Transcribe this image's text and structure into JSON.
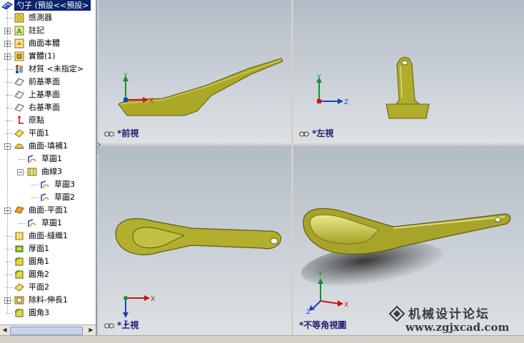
{
  "tree": {
    "root": "勺子 (預設<<預設>",
    "items": [
      {
        "label": "感測器",
        "icon": "sensor-icon",
        "expandable": false
      },
      {
        "label": "註記",
        "icon": "annotation-icon",
        "expandable": true
      },
      {
        "label": "曲面本體",
        "icon": "surface-bodies-icon",
        "expandable": true
      },
      {
        "label": "實體(1)",
        "icon": "solid-bodies-icon",
        "expandable": true
      },
      {
        "label": "材質 <未指定>",
        "icon": "material-icon",
        "expandable": false
      },
      {
        "label": "前基準面",
        "icon": "plane-icon",
        "expandable": false
      },
      {
        "label": "上基準面",
        "icon": "plane-icon",
        "expandable": false
      },
      {
        "label": "右基準面",
        "icon": "plane-icon",
        "expandable": false
      },
      {
        "label": "原點",
        "icon": "origin-icon",
        "expandable": false
      },
      {
        "label": "平面1",
        "icon": "plane-feature-icon",
        "expandable": false
      },
      {
        "label": "曲面-填補1",
        "icon": "surface-fill-icon",
        "expandable": true,
        "expanded": true
      },
      {
        "label": "草圖1",
        "icon": "sketch-icon",
        "level": 1
      },
      {
        "label": "曲線3",
        "icon": "curve-icon",
        "level": 1,
        "expandable": true,
        "expanded": true
      },
      {
        "label": "草圖3",
        "icon": "sketch-icon",
        "level": 2
      },
      {
        "label": "草圖2",
        "icon": "sketch-icon",
        "level": 2
      },
      {
        "label": "曲面-平面1",
        "icon": "planar-surface-icon",
        "expandable": true,
        "expanded": true
      },
      {
        "label": "草圖1",
        "icon": "sketch-icon",
        "level": 1
      },
      {
        "label": "曲面-縫織1",
        "icon": "knit-surface-icon",
        "expandable": false
      },
      {
        "label": "厚面1",
        "icon": "thicken-icon",
        "expandable": false
      },
      {
        "label": "圓角1",
        "icon": "fillet-icon",
        "expandable": false
      },
      {
        "label": "圓角2",
        "icon": "fillet-icon",
        "expandable": false
      },
      {
        "label": "平面2",
        "icon": "plane-feature-icon",
        "expandable": false
      },
      {
        "label": "除料-伸長1",
        "icon": "cut-extrude-icon",
        "expandable": true
      },
      {
        "label": "圓角3",
        "icon": "fillet-icon",
        "expandable": false
      }
    ]
  },
  "viewports": {
    "front": {
      "label": "*前視"
    },
    "left": {
      "label": "*左視"
    },
    "top": {
      "label": "*上視"
    },
    "iso": {
      "label": "*不等角視圖"
    }
  },
  "axes": {
    "x": "X",
    "y": "Y",
    "z": "Z"
  },
  "watermark": {
    "cn": "机械设计论坛",
    "url": "www.zgjxcad.com"
  },
  "colors": {
    "model": "#b5b235",
    "model_dark": "#6f6b12",
    "axis_x": "#d01010",
    "axis_y": "#109030",
    "axis_z": "#1a3fc0",
    "tree_select": "#0a246a"
  }
}
